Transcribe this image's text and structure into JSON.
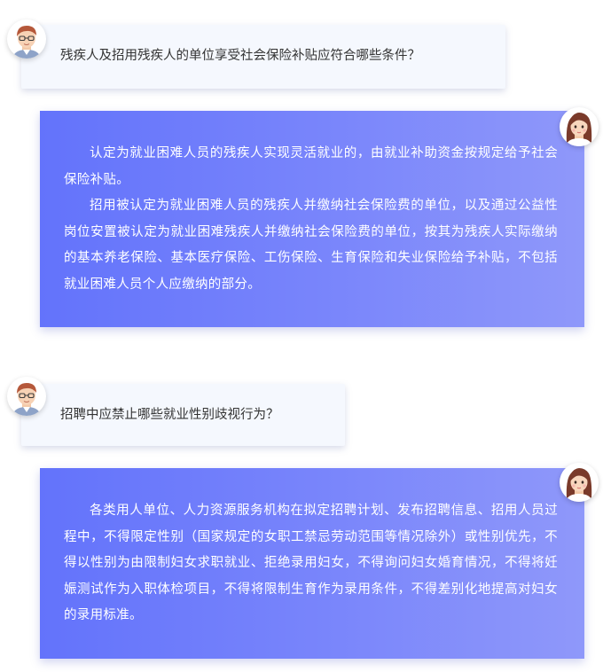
{
  "colors": {
    "question_bg": "#f5f8fe",
    "answer_gradient_start": "#6373fb",
    "answer_gradient_end": "#8f98fa",
    "answer_text": "#ffffff"
  },
  "qa": [
    {
      "question": "残疾人及招用残疾人的单位享受社会保险补贴应符合哪些条件？",
      "answer_paragraphs": [
        "认定为就业困难人员的残疾人实现灵活就业的，由就业补助资金按规定给予社会保险补贴。",
        "招用被认定为就业困难人员的残疾人并缴纳社会保险费的单位，以及通过公益性岗位安置被认定为就业困难残疾人并缴纳社会保险费的单位，按其为残疾人实际缴纳的基本养老保险、基本医疗保险、工伤保险、生育保险和失业保险给予补贴，不包括就业困难人员个人应缴纳的部分。"
      ]
    },
    {
      "question": "招聘中应禁止哪些就业性别歧视行为？",
      "answer_paragraphs": [
        "各类用人单位、人力资源服务机构在拟定招聘计划、发布招聘信息、招用人员过程中，不得限定性别（国家规定的女职工禁忌劳动范围等情况除外）或性别优先，不得以性别为由限制妇女求职就业、拒绝录用妇女，不得询问妇女婚育情况，不得将妊娠测试作为入职体检项目，不得将限制生育作为录用条件，不得差别化地提高对妇女的录用标准。"
      ]
    }
  ]
}
